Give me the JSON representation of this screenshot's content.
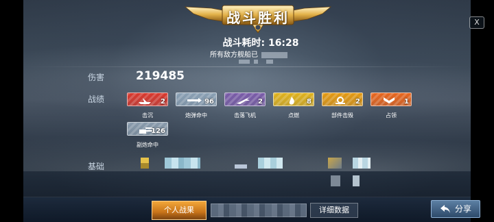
{
  "banner": {
    "title": "战斗胜利"
  },
  "close": {
    "icon": "close-icon",
    "label": "X"
  },
  "battle": {
    "time_label": "战斗耗时: ",
    "time_value": "16:28",
    "enemy_text": "所有敌方舰船已"
  },
  "stats": {
    "damage_label": "伤害",
    "damage_value": "219485",
    "record_label": "战绩",
    "base_label": "基础"
  },
  "medals": [
    {
      "name": "击沉",
      "count": "2",
      "icon": "sink-ship-icon",
      "color": "#d9392e"
    },
    {
      "name": "炮弹命中",
      "count": "96",
      "icon": "shell-hit-icon",
      "color": "#8aa0b4"
    },
    {
      "name": "击落飞机",
      "count": "2",
      "icon": "plane-down-icon",
      "color": "#7a5ca8"
    },
    {
      "name": "点燃",
      "count": "8",
      "icon": "fire-icon",
      "color": "#e0b21c"
    },
    {
      "name": "部件击毁",
      "count": "2",
      "icon": "gear-break-icon",
      "color": "#e59a12"
    },
    {
      "name": "占领",
      "count": "1",
      "icon": "capture-chevron-icon",
      "color": "#e8661e"
    },
    {
      "name": "副炮命中",
      "count": "126",
      "icon": "secondary-gun-icon",
      "color": "#8a9cad"
    }
  ],
  "bottom": {
    "tab_personal": "个人战果",
    "tab_detail": "详细数据",
    "share_label": "分享",
    "share_icon": "share-arrow-icon"
  },
  "colors": {
    "accent_orange": "#f2a73a",
    "share_blue": "#5c7fa3",
    "label_blue": "#c9d6e3"
  }
}
